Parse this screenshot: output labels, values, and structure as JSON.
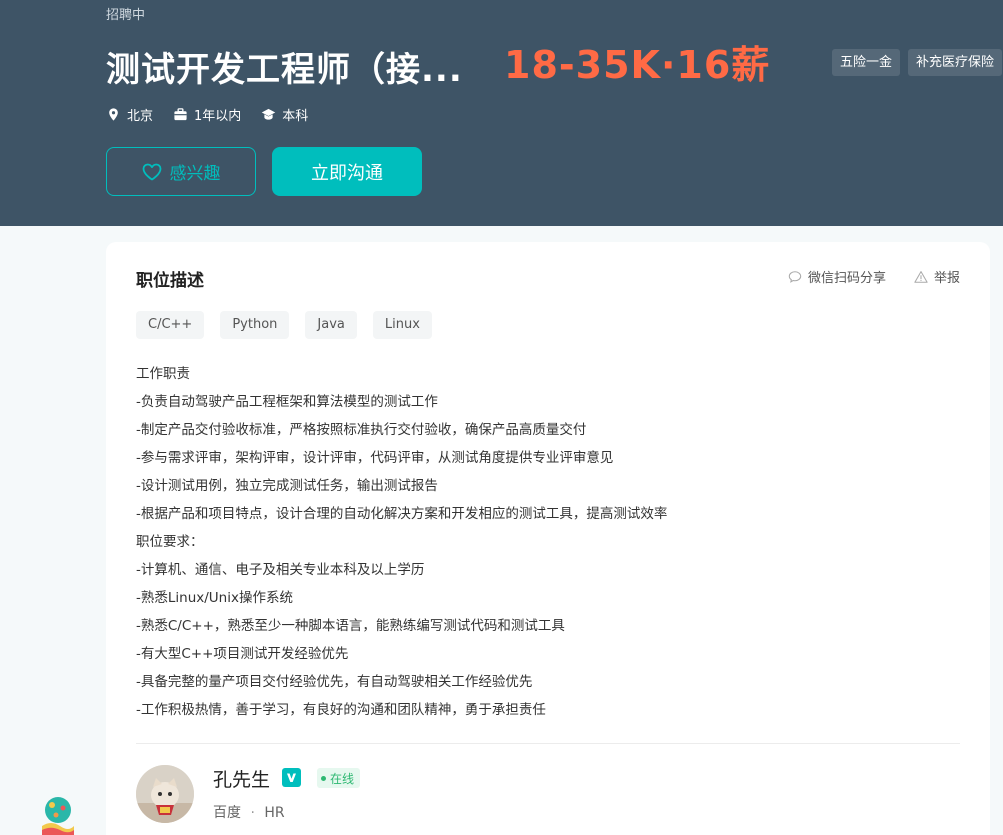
{
  "header": {
    "status": "招聘中",
    "job_title": "测试开发工程师（接...",
    "salary": "18-35K·16薪",
    "benefits": [
      "五险一金",
      "补充医疗保险"
    ],
    "meta": {
      "location": "北京",
      "experience": "1年以内",
      "education": "本科"
    },
    "interest_label": "感兴趣",
    "chat_label": "立即沟通"
  },
  "card": {
    "section_title": "职位描述",
    "share_label": "微信扫码分享",
    "report_label": "举报",
    "skills": [
      "C/C++",
      "Python",
      "Java",
      "Linux"
    ],
    "description": [
      "工作职责",
      "-负责自动驾驶产品工程框架和算法模型的测试工作",
      "-制定产品交付验收标准，严格按照标准执行交付验收，确保产品高质量交付",
      "-参与需求评审，架构评审，设计评审，代码评审，从测试角度提供专业评审意见",
      "-设计测试用例，独立完成测试任务，输出测试报告",
      "-根据产品和项目特点，设计合理的自动化解决方案和开发相应的测试工具，提高测试效率",
      "职位要求：",
      "-计算机、通信、电子及相关专业本科及以上学历",
      "-熟悉Linux/Unix操作系统",
      "-熟悉C/C++，熟悉至少一种脚本语言，能熟练编写测试代码和测试工具",
      "-有大型C++项目测试开发经验优先",
      "-具备完整的量产项目交付经验优先，有自动驾驶相关工作经验优先",
      "-工作积极热情，善于学习，有良好的沟通和团队精神，勇于承担责任"
    ],
    "recruiter": {
      "name": "孔先生",
      "online_label": "在线",
      "company": "百度",
      "separator": "·",
      "role": "HR"
    }
  },
  "colors": {
    "header_bg": "#3e5466",
    "accent": "#00bebd",
    "salary": "#ff6a45",
    "online": "#2eb872"
  }
}
